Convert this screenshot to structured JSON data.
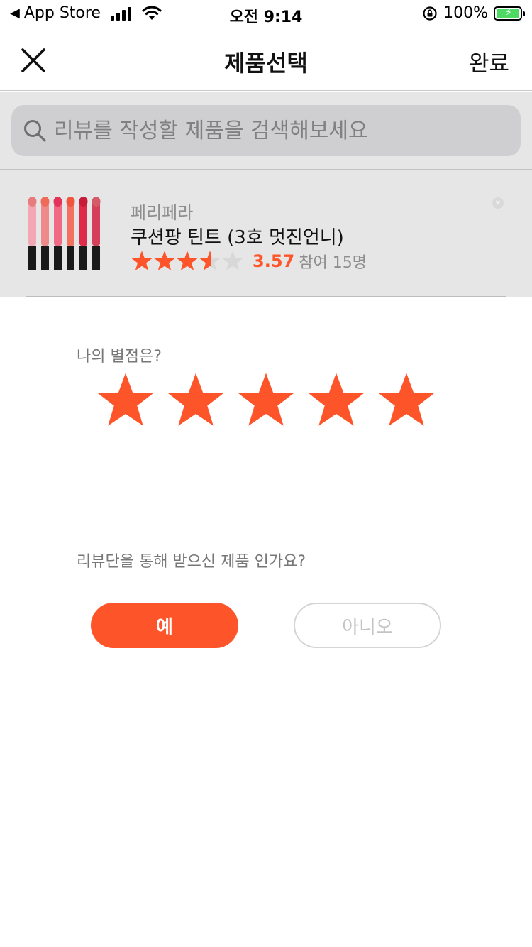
{
  "status_bar": {
    "back_label": "App Store",
    "time": "오전 9:14",
    "battery_percent": "100%",
    "battery_level": 1.0,
    "icons": [
      "signal-icon",
      "wifi-icon",
      "rotation-lock-icon",
      "battery-icon"
    ]
  },
  "nav": {
    "title": "제품선택",
    "close_icon": "close-icon",
    "done_label": "완료"
  },
  "search": {
    "placeholder": "리뷰를 작성할 제품을 검색해보세요",
    "value": ""
  },
  "product": {
    "brand": "페리페라",
    "name": "쿠션팡 틴트 (3호 멋진언니)",
    "rating_value": 3.57,
    "rating_display": "3.57",
    "participants": "참여 15명",
    "stars_max": 5
  },
  "review": {
    "rating_label": "나의 별점은?",
    "my_rating": 5,
    "question": "리뷰단을 통해 받으신 제품 인가요?",
    "yes_label": "예",
    "no_label": "아니오"
  },
  "colors": {
    "accent": "#fe5429",
    "star_empty": "#d8d8d8",
    "panel_bg": "#e6e6e6",
    "muted_text": "#8e8e8e"
  }
}
